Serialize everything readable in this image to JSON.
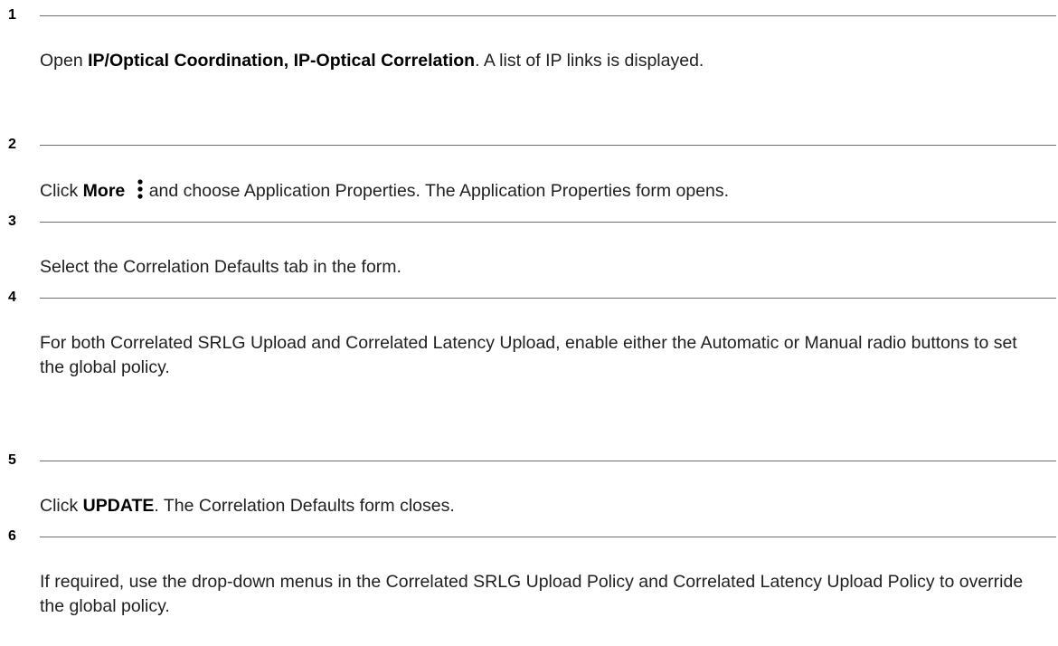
{
  "steps": [
    {
      "number": "1",
      "pre": "Open ",
      "bold": "IP/Optical Coordination, IP-Optical Correlation",
      "post": ". A list of IP links is displayed."
    },
    {
      "number": "2",
      "pre": "Click ",
      "bold": "More",
      "icon": "more-vertical-icon",
      "post": "and choose Application Properties. The Application Properties form opens."
    },
    {
      "number": "3",
      "text": "Select the Correlation Defaults tab in the form."
    },
    {
      "number": "4",
      "text": "For both Correlated SRLG Upload and Correlated Latency Upload, enable either the Automatic or Manual radio buttons to set the global policy."
    },
    {
      "number": "5",
      "pre": "Click ",
      "bold": "UPDATE",
      "post": ". The Correlation Defaults form closes."
    },
    {
      "number": "6",
      "text": "If required, use the drop-down menus in the Correlated SRLG Upload Policy and Correlated Latency Upload Policy to override the global policy."
    }
  ]
}
